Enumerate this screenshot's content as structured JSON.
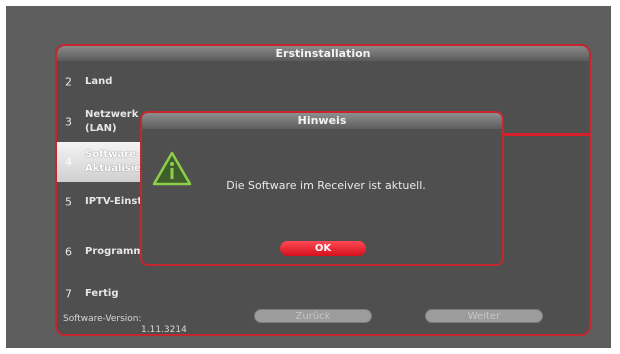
{
  "wizard": {
    "title": "Erstinstallation",
    "steps": [
      {
        "num": "2",
        "label": "Land"
      },
      {
        "num": "3",
        "label": "Netzwerk\n(LAN)"
      },
      {
        "num": "4",
        "label": "Software-\nAktualisier"
      },
      {
        "num": "5",
        "label": "IPTV-Einste"
      },
      {
        "num": "6",
        "label": "Programms"
      },
      {
        "num": "7",
        "label": "Fertig"
      }
    ],
    "active_step": "4",
    "version_label": "Software-Version:",
    "version_value": "1.11.3214",
    "back_label": "Zurück",
    "next_label": "Weiter"
  },
  "dialog": {
    "title": "Hinweis",
    "icon": "warning-icon",
    "message": "Die Software im Receiver ist aktuell.",
    "ok_label": "OK"
  },
  "colors": {
    "accent_red": "#d6202a",
    "warning_green": "#8fce4a"
  }
}
